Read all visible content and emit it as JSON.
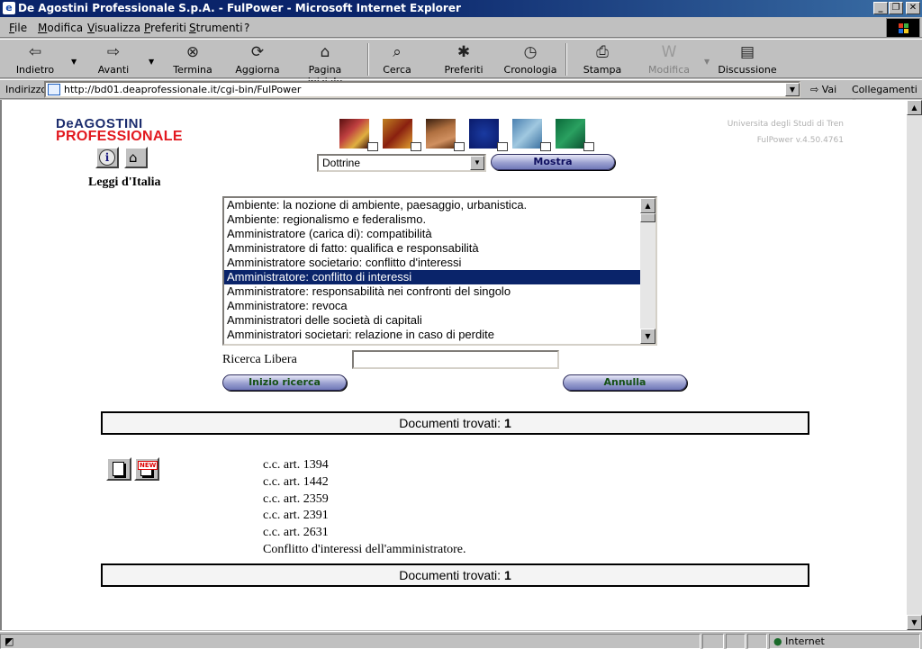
{
  "window": {
    "title": "De Agostini Professionale S.p.A. - FulPower - Microsoft Internet Explorer",
    "buttons": [
      "_",
      "❐",
      "✕"
    ]
  },
  "menu": [
    "File",
    "Modifica",
    "Visualizza",
    "Preferiti",
    "Strumenti",
    "?"
  ],
  "toolbar": {
    "back": "Indietro",
    "forward": "Avanti",
    "stop": "Termina",
    "refresh": "Aggiorna",
    "home": "Pagina iniziale",
    "search": "Cerca",
    "favorites": "Preferiti",
    "history": "Cronologia",
    "print": "Stampa",
    "edit": "Modifica",
    "discuss": "Discussione"
  },
  "address": {
    "label": "Indirizzo",
    "url": "http://bd01.deaprofessionale.it/cgi-bin/FulPower",
    "go": "Vai",
    "links": "Collegamenti"
  },
  "page": {
    "logo_line1": "DeAGOSTINI",
    "logo_line2": "PROFESSIONALE",
    "section_title": "Leggi d'Italia",
    "university": "Universita degli Studi di Tren",
    "version": "FulPower v.4.50.4761",
    "dropdown_value": "Dottrine",
    "mostra_label": "Mostra",
    "list_items": [
      "Ambiente: la nozione di ambiente, paesaggio, urbanistica.",
      "Ambiente: regionalismo e federalismo.",
      "Amministratore (carica di): compatibilità",
      "Amministratore di fatto: qualifica e responsabilità",
      "Amministratore societario: conflitto d'interessi",
      "Amministratore: conflitto di interessi",
      "Amministratore: responsabilità nei confronti del singolo",
      "Amministratore: revoca",
      "Amministratori delle società di capitali",
      "Amministratori societari: relazione in caso di perdite"
    ],
    "selected_index": 5,
    "ricerca_label": "Ricerca Libera",
    "ricerca_value": "",
    "start_search_label": "Inizio ricerca",
    "cancel_label": "Annulla",
    "docs_found_label": "Documenti trovati:",
    "docs_found_count": "1",
    "new_tag": "NEW",
    "result_lines": [
      "c.c. art. 1394",
      "c.c. art. 1442",
      "c.c. art. 2359",
      "c.c. art. 2391",
      "c.c. art. 2631",
      "Conflitto d'interessi dell'amministratore."
    ]
  },
  "status": {
    "zone": "Internet"
  }
}
